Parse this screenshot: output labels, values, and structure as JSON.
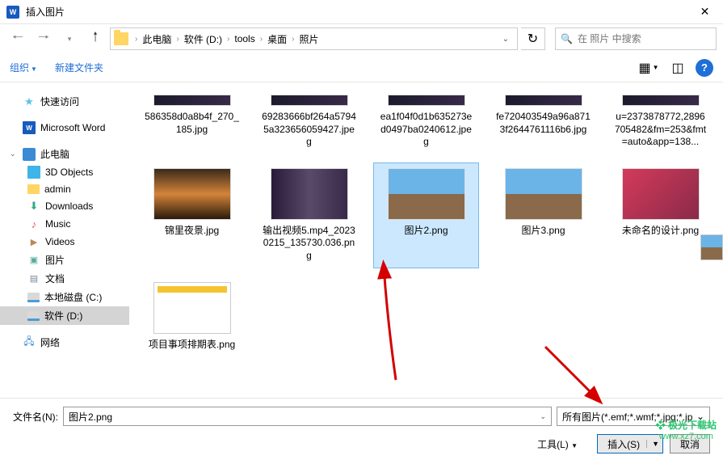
{
  "title": "插入图片",
  "breadcrumb": [
    "此电脑",
    "软件 (D:)",
    "tools",
    "桌面",
    "照片"
  ],
  "search_placeholder": "在 照片 中搜索",
  "toolbar": {
    "organize": "组织",
    "newfolder": "新建文件夹"
  },
  "sidebar": {
    "quick": "快速访问",
    "word": "Microsoft Word",
    "pc": "此电脑",
    "items": [
      "3D Objects",
      "admin",
      "Downloads",
      "Music",
      "Videos",
      "图片",
      "文档",
      "本地磁盘 (C:)",
      "软件 (D:)"
    ],
    "network": "网络"
  },
  "files": [
    {
      "name": "586358d0a8b4f_270_185.jpg"
    },
    {
      "name": "69283666bf264a57945a323656059427.jpeg"
    },
    {
      "name": "ea1f04f0d1b635273ed0497ba0240612.jpeg"
    },
    {
      "name": "fe720403549a96a8713f2644761116b6.jpg"
    },
    {
      "name": "u=2373878772,2896705482&fm=253&fmt=auto&app=138..."
    },
    {
      "name": "锦里夜景.jpg"
    },
    {
      "name": "输出视频5.mp4_20230215_135730.036.png"
    },
    {
      "name": "图片2.png",
      "selected": true
    },
    {
      "name": "图片3.png"
    },
    {
      "name": "未命名的设计.png"
    },
    {
      "name": "项目事项排期表.png"
    }
  ],
  "filename_label": "文件名(N):",
  "filename_value": "图片2.png",
  "filetype": "所有图片(*.emf;*.wmf;*.jpg;*.jp",
  "tools_label": "工具(L)",
  "insert_label": "插入(S)",
  "cancel_label": "取消",
  "watermark": {
    "line1": "❖ 极光下载站",
    "line2": "www.xz7.com"
  }
}
